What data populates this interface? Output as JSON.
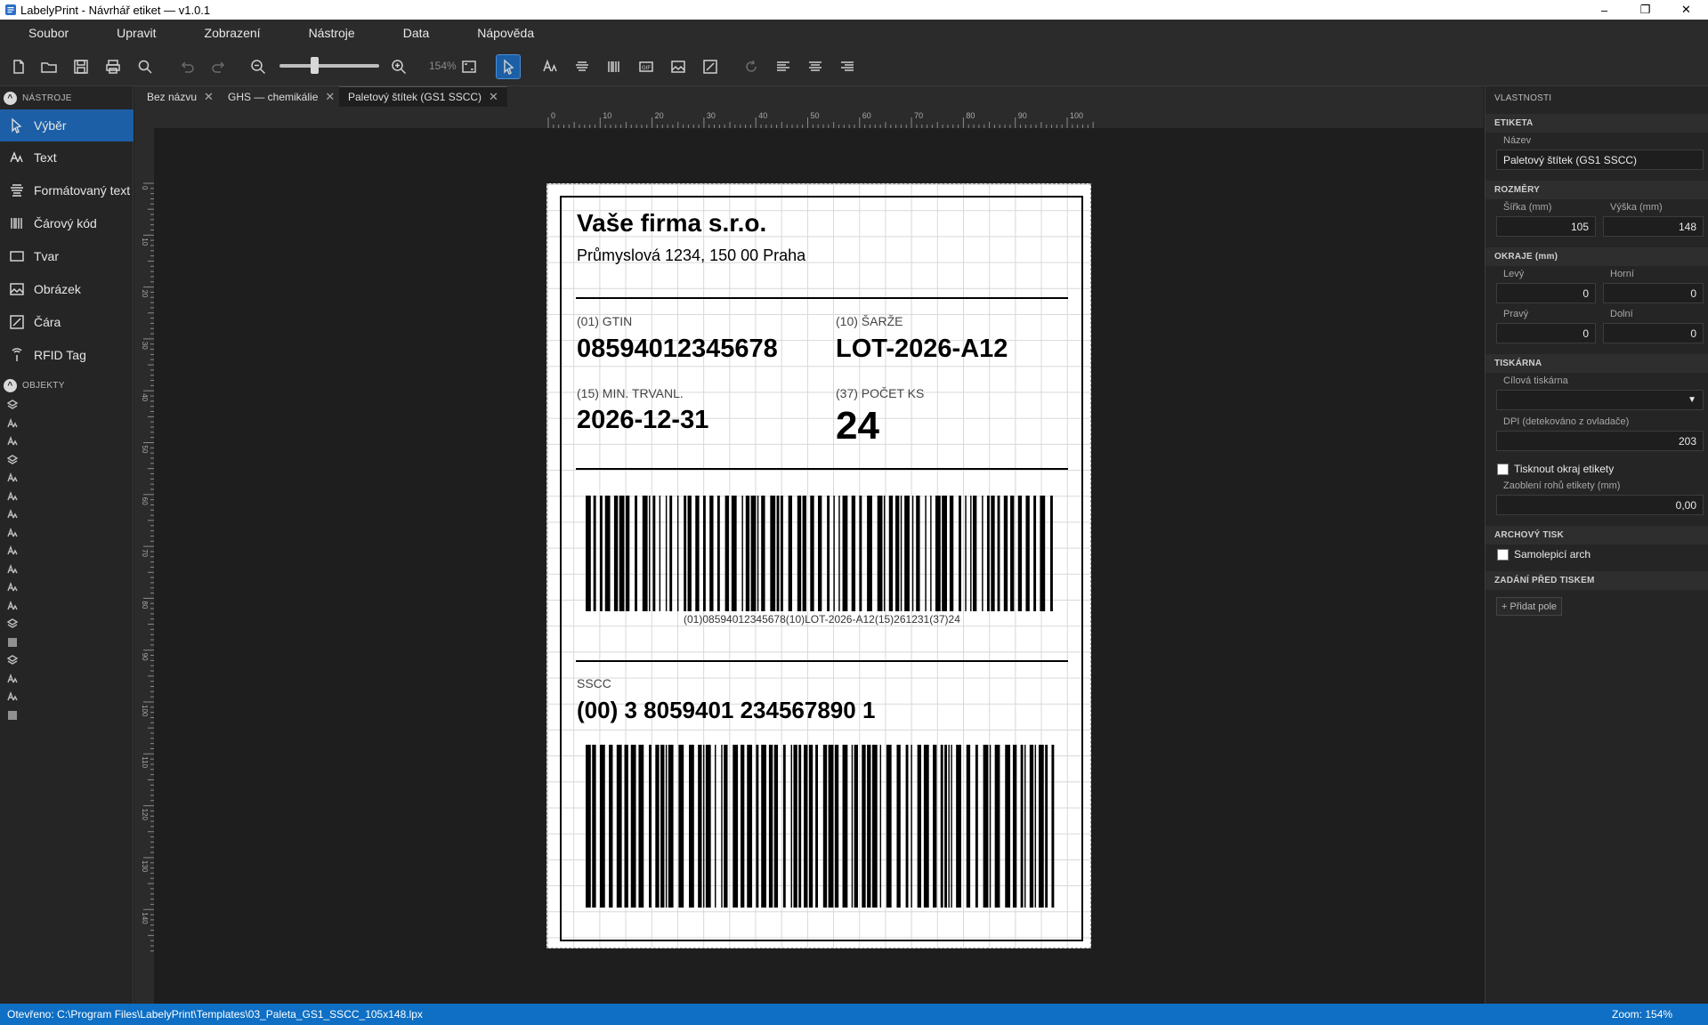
{
  "window": {
    "title": "LabelyPrint - Návrhář etiket — v1.0.1",
    "minimize": "–",
    "maximize": "❐",
    "close": "✕"
  },
  "menu": [
    "Soubor",
    "Upravit",
    "Zobrazení",
    "Nástroje",
    "Data",
    "Nápověda"
  ],
  "toolbar": {
    "zoom_percent": "154%",
    "zoom_slider_value": 0.35
  },
  "tools_section": "NÁSTROJE",
  "tools": [
    {
      "label": "Výběr",
      "icon": "cursor-icon"
    },
    {
      "label": "Text",
      "icon": "text-icon"
    },
    {
      "label": "Formátovaný text",
      "icon": "rich-text-icon"
    },
    {
      "label": "Čárový kód",
      "icon": "barcode-icon"
    },
    {
      "label": "Tvar",
      "icon": "shape-icon"
    },
    {
      "label": "Obrázek",
      "icon": "image-icon"
    },
    {
      "label": "Čára",
      "icon": "line-icon"
    },
    {
      "label": "RFID Tag",
      "icon": "rfid-icon"
    }
  ],
  "objects_section": "OBJEKTY",
  "objects": [
    "rich-text",
    "text",
    "text",
    "rich-text",
    "text",
    "text",
    "text",
    "text",
    "text",
    "text",
    "text",
    "text",
    "rich-text",
    "barcode",
    "rich-text",
    "text",
    "text",
    "barcode"
  ],
  "tabs": [
    {
      "label": "Bez názvu",
      "close": "✕"
    },
    {
      "label": "GHS — chemikálie",
      "close": "✕"
    },
    {
      "label": "Paletový štítek (GS1 SSCC)",
      "close": "✕"
    }
  ],
  "ruler": {
    "h": [
      "0",
      "10",
      "20",
      "30",
      "40",
      "50",
      "60",
      "70",
      "80",
      "90",
      "100"
    ],
    "v": [
      "0",
      "10",
      "20",
      "30",
      "40",
      "50",
      "60",
      "70",
      "80",
      "90",
      "100",
      "110",
      "120",
      "130",
      "140"
    ]
  },
  "label": {
    "company": "Vaše firma s.r.o.",
    "address": "Průmyslová 1234, 150 00 Praha",
    "gtin_caption": "(01) GTIN",
    "gtin_value": "08594012345678",
    "batch_caption": "(10) ŠARŽE",
    "batch_value": "LOT-2026-A12",
    "bestbefore_caption": "(15) MIN. TRVANL.",
    "bestbefore_value": "2026-12-31",
    "count_caption": "(37) POČET KS",
    "count_value": "24",
    "barcode1_text": "(01)08594012345678(10)LOT-2026-A12(15)261231(37)24",
    "sscc_caption": "SSCC",
    "sscc_value": "(00) 3 8059401 234567890 1"
  },
  "properties": {
    "title": "VLASTNOSTI",
    "label_section": "ETIKETA",
    "name_label": "Název",
    "name_value": "Paletový štítek (GS1 SSCC)",
    "dims_section": "ROZMĚRY",
    "width_label": "Šířka (mm)",
    "width_value": "105",
    "height_label": "Výška (mm)",
    "height_value": "148",
    "margins_section": "OKRAJE (mm)",
    "left_label": "Levý",
    "left_value": "0",
    "top_label": "Horní",
    "top_value": "0",
    "right_label": "Pravý",
    "right_value": "0",
    "bottom_label": "Dolní",
    "bottom_value": "0",
    "printer_section": "TISKÁRNA",
    "target_printer_label": "Cílová tiskárna",
    "target_printer_value": "",
    "dpi_label": "DPI (detekováno z ovladače)",
    "dpi_value": "203",
    "print_border_label": "Tisknout okraj etikety",
    "print_border_checked": false,
    "corner_label": "Zaoblení rohů etikety (mm)",
    "corner_value": "0,00",
    "sheet_section": "ARCHOVÝ TISK",
    "sheet_label": "Samolepicí arch",
    "sheet_checked": false,
    "prompt_section": "ZADÁNÍ PŘED TISKEM",
    "add_field": "+ Přidat pole"
  },
  "status": {
    "left": "Otevřeno: C:\\Program Files\\LabelyPrint\\Templates\\03_Paleta_GS1_SSCC_105x148.lpx",
    "right": "Zoom: 154%"
  }
}
